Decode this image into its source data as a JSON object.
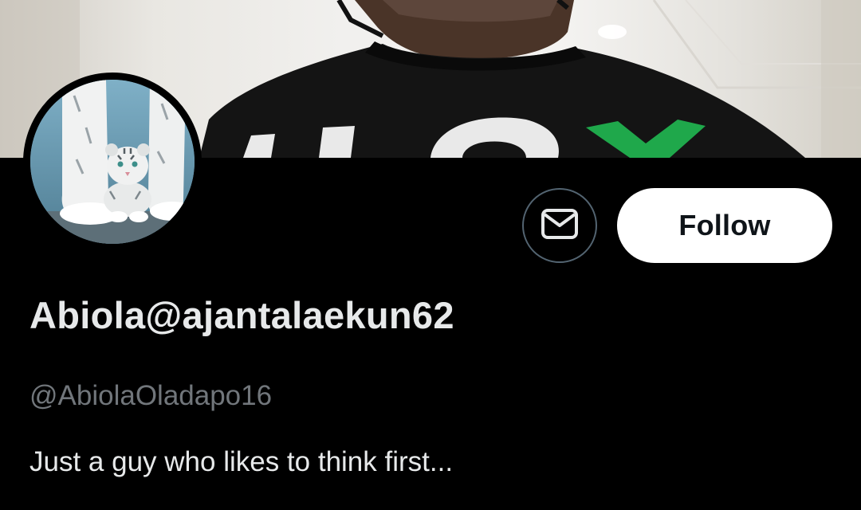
{
  "profile": {
    "display_name": "Abiola@ajantalaekun62",
    "handle": "@AbiolaOladapo16",
    "bio": "Just a guy who likes to think first..."
  },
  "actions": {
    "message_icon": "envelope-icon",
    "follow_label": "Follow"
  },
  "media": {
    "banner": "photo of a person in a black t-shirt with white and green lettering, indoor ceiling lights",
    "avatar": "white tiger cub between adult tiger legs"
  },
  "colors": {
    "background": "#000000",
    "primary_text": "#e7e9ea",
    "secondary_text": "#71767b",
    "button_border": "#536471",
    "follow_bg": "#ffffff",
    "follow_text": "#0f1419",
    "banner_green": "#1fa84b"
  }
}
